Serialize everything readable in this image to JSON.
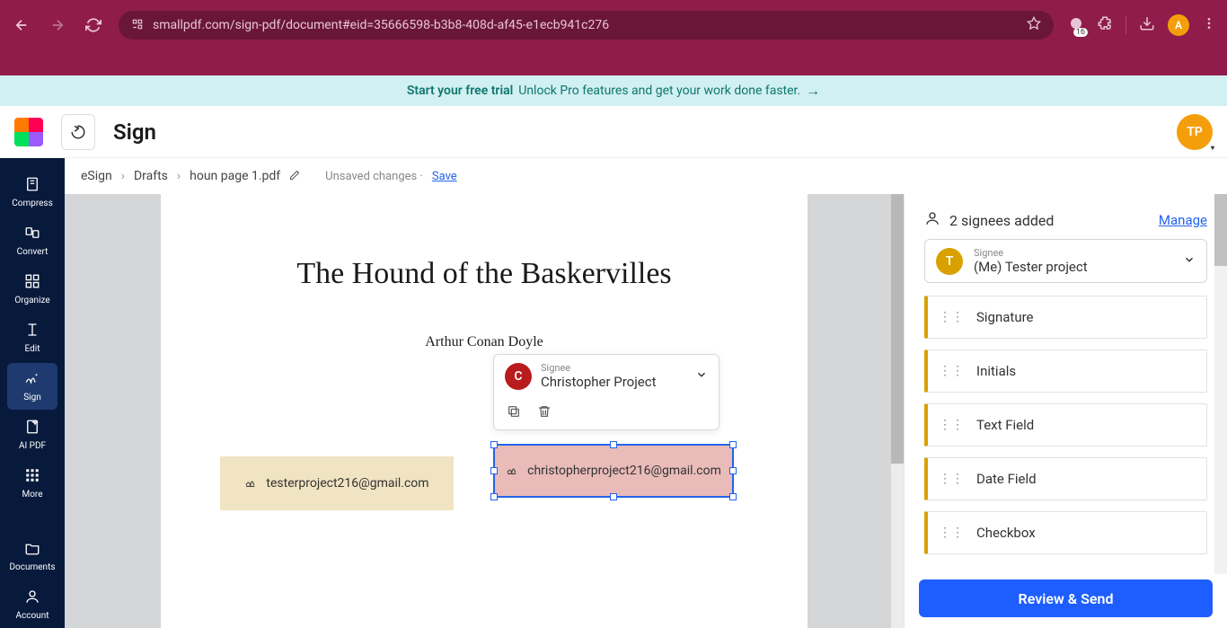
{
  "browser": {
    "url": "smallpdf.com/sign-pdf/document#eid=35666598-b3b8-408d-af45-e1ecb941c276",
    "ext_count": "16",
    "profile_initial": "A"
  },
  "promo": {
    "bold": "Start your free trial",
    "text": "Unlock Pro features and get your work done faster."
  },
  "header": {
    "title": "Sign",
    "user_initials": "TP"
  },
  "sidebar": {
    "items": [
      {
        "label": "Compress"
      },
      {
        "label": "Convert"
      },
      {
        "label": "Organize"
      },
      {
        "label": "Edit"
      },
      {
        "label": "Sign"
      },
      {
        "label": "AI PDF"
      },
      {
        "label": "More"
      },
      {
        "label": "Documents"
      },
      {
        "label": "Account"
      }
    ]
  },
  "breadcrumb": {
    "root": "eSign",
    "drafts": "Drafts",
    "file": "houn page 1.pdf",
    "status": "Unsaved changes",
    "save": "Save"
  },
  "document": {
    "title": "The Hound of the Baskervilles",
    "author": "Arthur Conan Doyle",
    "field1_email": "testerproject216@gmail.com",
    "field2_email": "christopherproject216@gmail.com"
  },
  "popup": {
    "avatar_initial": "C",
    "label": "Signee",
    "name": "Christopher Project"
  },
  "right_panel": {
    "signees_count": "2 signees added",
    "manage": "Manage",
    "selected_avatar": "T",
    "selected_label": "Signee",
    "selected_name": "(Me) Tester project",
    "fields": [
      {
        "label": "Signature"
      },
      {
        "label": "Initials"
      },
      {
        "label": "Text Field"
      },
      {
        "label": "Date Field"
      },
      {
        "label": "Checkbox"
      }
    ],
    "send_button": "Review & Send"
  }
}
